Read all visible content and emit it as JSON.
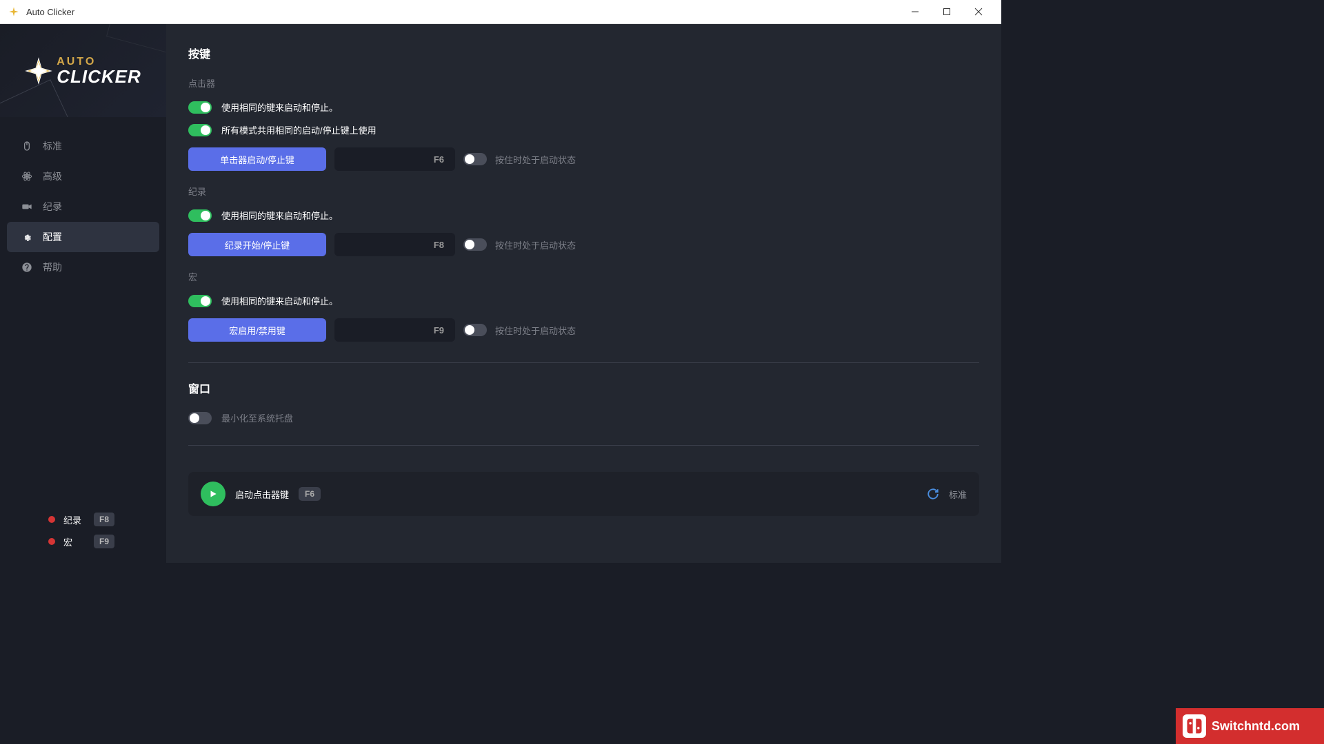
{
  "titlebar": {
    "title": "Auto Clicker"
  },
  "logo": {
    "top": "AUTO",
    "bottom": "CLICKER"
  },
  "nav": {
    "standard": "标准",
    "advanced": "高级",
    "record": "纪录",
    "config": "配置",
    "help": "帮助"
  },
  "bottom_status": {
    "record": {
      "label": "纪录",
      "key": "F8"
    },
    "macro": {
      "label": "宏",
      "key": "F9"
    }
  },
  "sections": {
    "keys_title": "按键",
    "clicker": {
      "label": "点击器",
      "same_key": "使用相同的键来启动和停止。",
      "all_modes": "所有模式共用相同的启动/停止键上使用",
      "btn": "单击器启动/停止键",
      "key": "F6",
      "hold": "按住时处于启动状态"
    },
    "record": {
      "label": "纪录",
      "same_key": "使用相同的键来启动和停止。",
      "btn": "纪录开始/停止键",
      "key": "F8",
      "hold": "按住时处于启动状态"
    },
    "macro": {
      "label": "宏",
      "same_key": "使用相同的键来启动和停止。",
      "btn": "宏启用/禁用键",
      "key": "F9",
      "hold": "按住时处于启动状态"
    },
    "window_title": "窗口",
    "minimize_tray": "最小化至系统托盘"
  },
  "action_bar": {
    "label": "启动点击器键",
    "key": "F6",
    "mode": "标准"
  },
  "watermark": "Switchntd.com"
}
